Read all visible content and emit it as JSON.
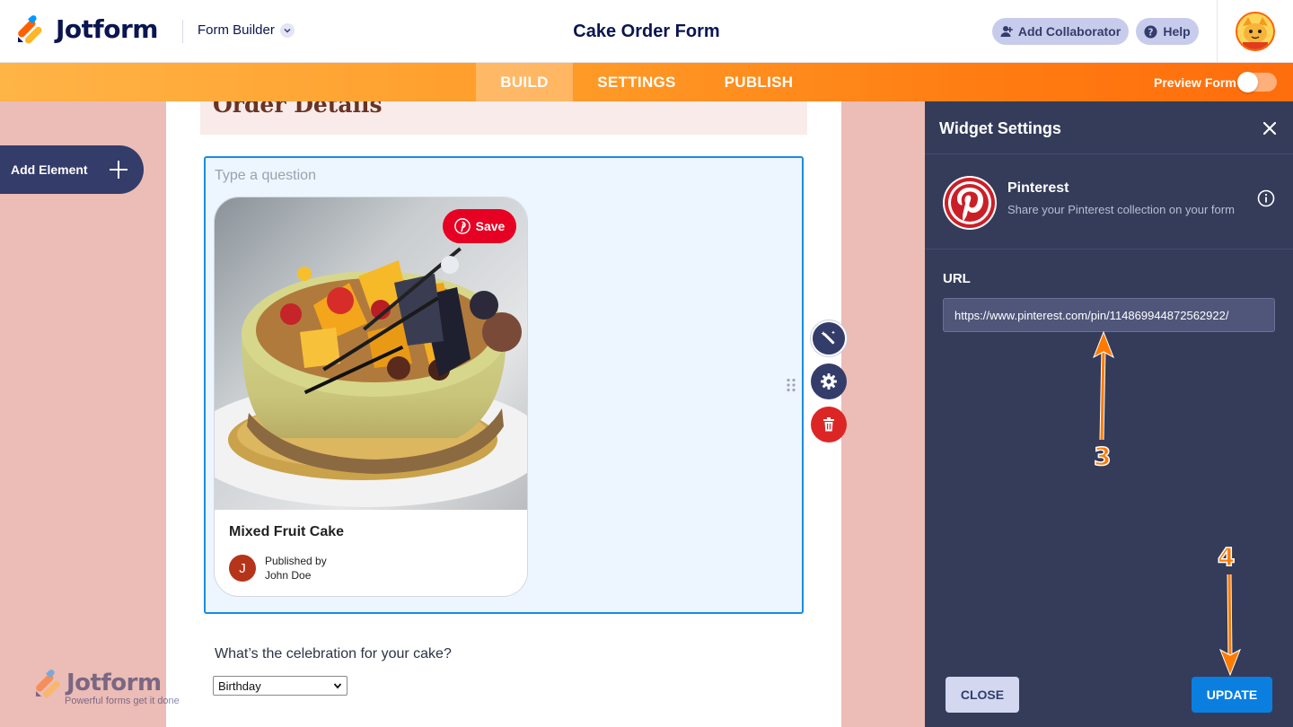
{
  "header": {
    "brand": "Jotform",
    "mode_label": "Form Builder",
    "form_title": "Cake Order Form",
    "add_collaborator_label": "Add Collaborator",
    "help_label": "Help"
  },
  "nav": {
    "tabs": [
      {
        "label": "BUILD",
        "active": true
      },
      {
        "label": "SETTINGS",
        "active": false
      },
      {
        "label": "PUBLISH",
        "active": false
      }
    ],
    "preview_label": "Preview Form",
    "preview_on": false
  },
  "sidebar": {
    "add_element_label": "Add Element"
  },
  "form": {
    "section_title": "Order Details",
    "question_placeholder": "Type a question",
    "pin": {
      "save_label": "Save",
      "title": "Mixed Fruit Cake",
      "avatar_letter": "J",
      "published_by_line1": "Published by",
      "published_by_line2": "John Doe"
    },
    "celebration_question": "What’s the celebration for your cake?",
    "celebration_selected": "Birthday"
  },
  "watermark": {
    "brand": "Jotform",
    "tagline": "Powerful forms get it done"
  },
  "panel": {
    "title": "Widget Settings",
    "widget_name": "Pinterest",
    "widget_description": "Share your Pinterest collection on your form",
    "url_label": "URL",
    "url_value": "https://www.pinterest.com/pin/114869944872562922/",
    "close_label": "CLOSE",
    "update_label": "UPDATE"
  },
  "annotations": {
    "step3": "3",
    "step4": "4"
  },
  "colors": {
    "brand_orange": "#ff6100",
    "panel_bg": "#343c5a",
    "accent_blue": "#0a7fe0",
    "pinterest_red": "#e60023",
    "annotation": "#ff7a00"
  },
  "icons": [
    "jotform-logo-icon",
    "chevron-down-icon",
    "user-plus-icon",
    "help-circle-icon",
    "plus-icon",
    "pinterest-icon",
    "magic-wand-icon",
    "gear-icon",
    "trash-icon",
    "drag-handle-icon",
    "close-icon",
    "info-icon"
  ]
}
